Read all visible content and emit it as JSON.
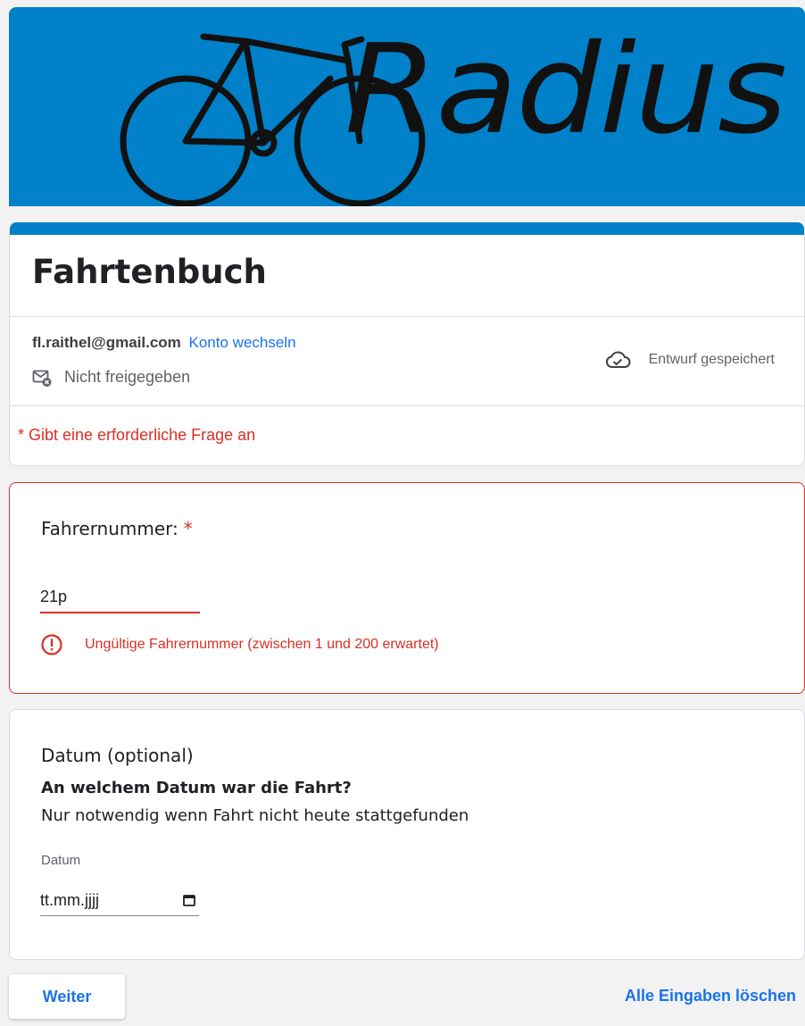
{
  "banner": {
    "logo_text": "Radius",
    "color": "#0081c9"
  },
  "form": {
    "title": "Fahrtenbuch",
    "account_email": "fl.raithel@gmail.com",
    "switch_account_label": "Konto wechseln",
    "sharing_status": "Nicht freigegeben",
    "save_status": "Entwurf gespeichert",
    "required_note": "* Gibt eine erforderliche Frage an"
  },
  "question1": {
    "label": "Fahrernummer:",
    "required_marker": "*",
    "value": "21p",
    "error": "Ungültige Fahrernummer (zwischen 1 und 200 erwartet)"
  },
  "question2": {
    "label": "Datum (optional)",
    "heading": "An welchem Datum war die Fahrt?",
    "description": "Nur notwendig wenn Fahrt nicht heute stattgefunden",
    "field_caption": "Datum",
    "date_placeholder": "tt.mm.jjjj"
  },
  "actions": {
    "next_label": "Weiter",
    "clear_label": "Alle Eingaben löschen"
  },
  "icons": {
    "not_shared": "mail-off-icon",
    "saved": "cloud-check-icon",
    "error": "error-icon",
    "calendar": "calendar-icon"
  },
  "colors": {
    "accent": "#1a73e8",
    "error": "#d93025",
    "brand": "#0081c9"
  }
}
